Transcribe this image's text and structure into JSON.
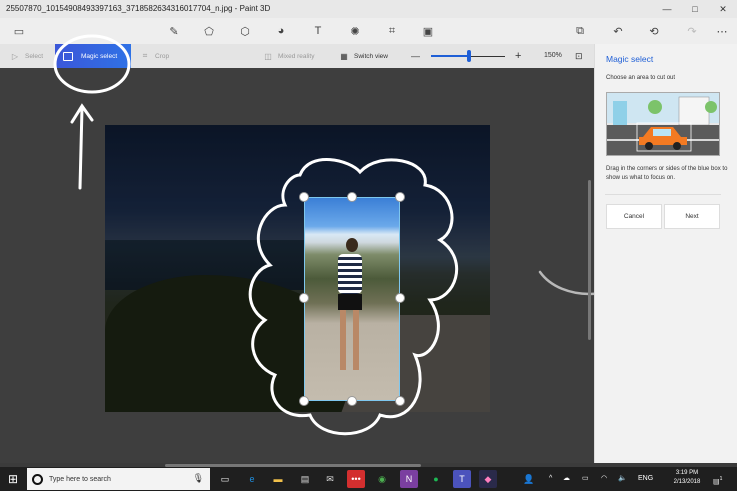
{
  "window": {
    "title": "25507870_10154908493397163_3718582634316017704_n.jpg - Paint 3D",
    "controls": [
      "—",
      "□",
      "✕"
    ]
  },
  "menubar": {
    "icons": [
      "menu-icon",
      "brush-icon",
      "2d-shapes-icon",
      "3d-shapes-icon",
      "stickers-icon",
      "text-icon",
      "effects-icon",
      "canvas-icon",
      "remix-icon",
      "paste-icon",
      "undo-icon",
      "history-icon",
      "redo-icon",
      "more-icon"
    ],
    "glyphs": {
      "menu": "▭",
      "brush": "✎",
      "shapes2d": "⬠",
      "shapes3d": "⬡",
      "stickers": "◕",
      "text": "T",
      "effects": "✺",
      "canvas": "⌗",
      "remix": "▣",
      "paste": "⧉",
      "undo": "↶",
      "history": "⟲",
      "redo": "↷",
      "more": "⋯"
    }
  },
  "toolbar": {
    "select_label": "Select",
    "magic_select_label": "Magic select",
    "crop_label": "Crop",
    "mixed_reality_label": "Mixed reality",
    "switch_view_label": "Switch view",
    "zoom_minus": "—",
    "zoom_plus": "+",
    "zoom_percent": "150%",
    "zoom_level": 0.5
  },
  "panel": {
    "title": "Magic select",
    "subtitle": "Choose an area to cut out",
    "help": "Drag in the corners or sides of the blue box to show us what to focus on.",
    "cancel_label": "Cancel",
    "next_label": "Next"
  },
  "taskbar": {
    "search_placeholder": "Type here to search",
    "lang": "ENG",
    "time": "3:19 PM",
    "date": "2/13/2018",
    "notification_count": "1"
  },
  "colors": {
    "accent": "#1f5fd6",
    "selection_border": "#7ec7ee"
  }
}
